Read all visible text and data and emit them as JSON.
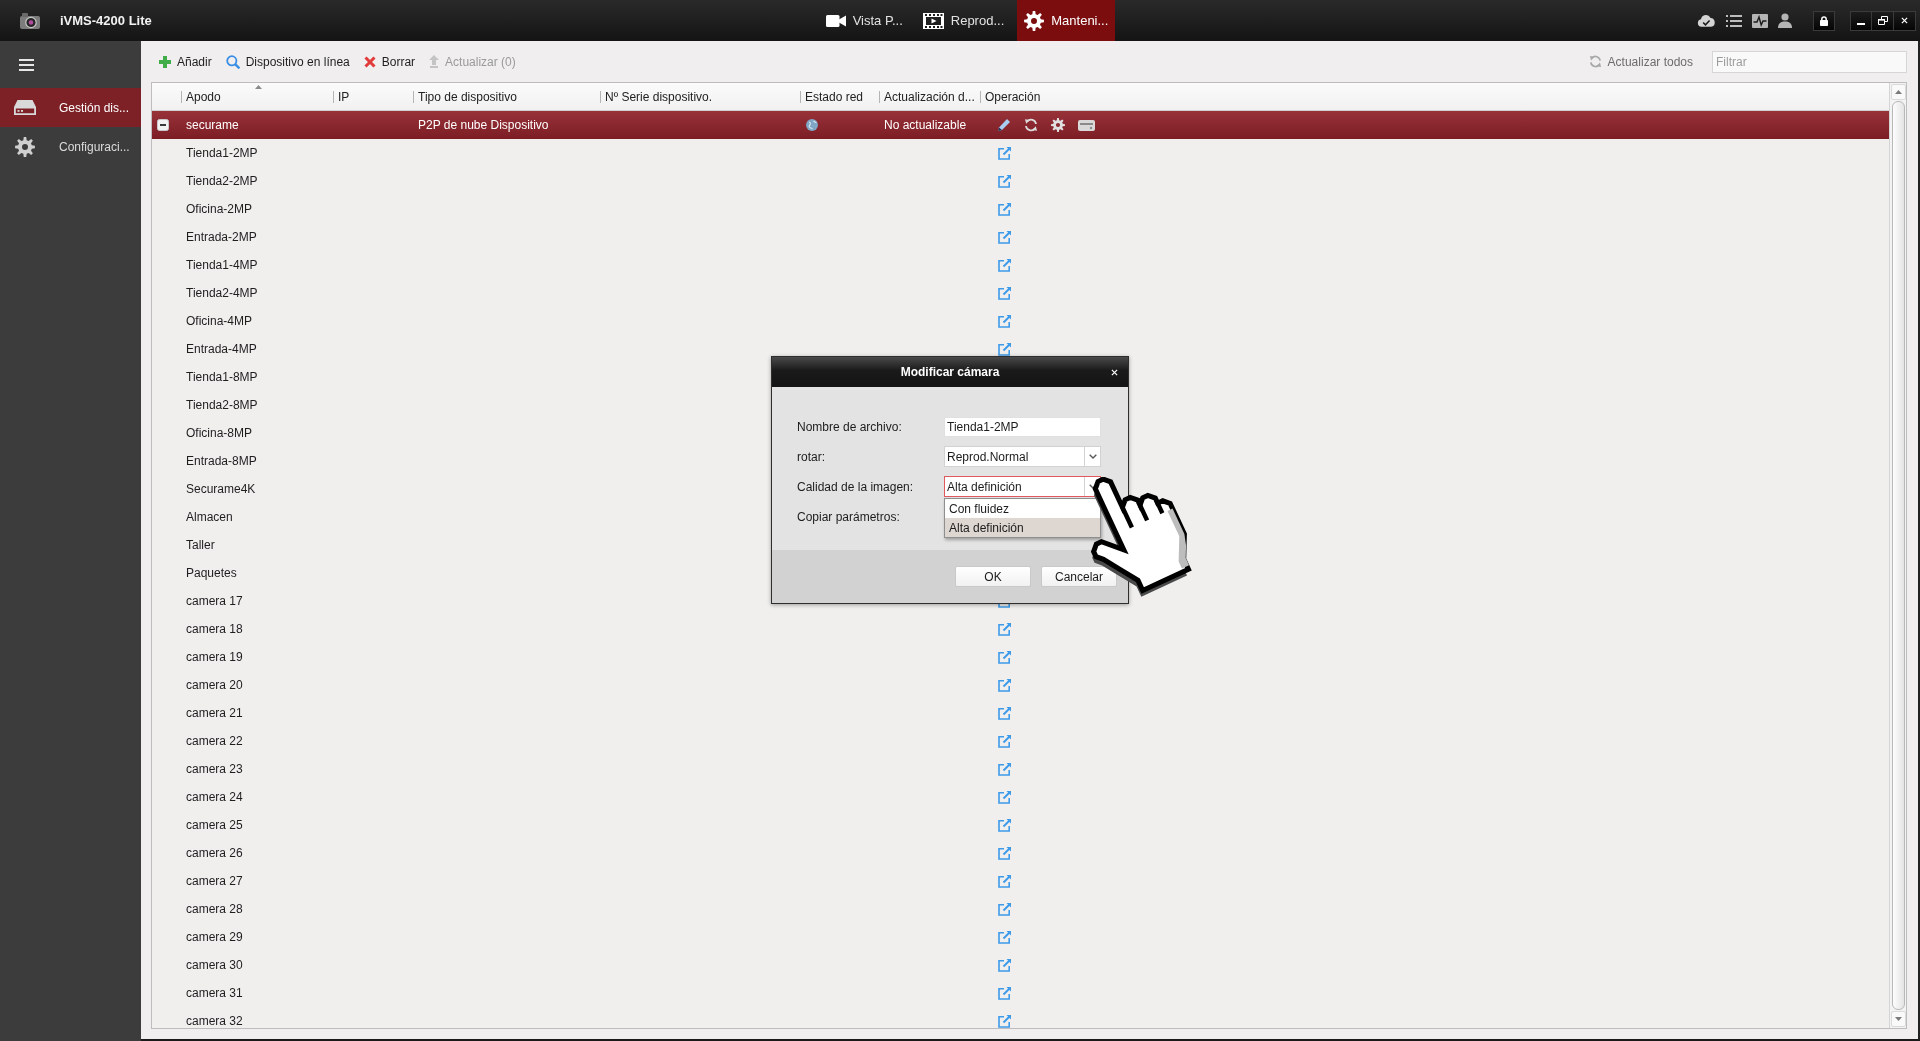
{
  "window": {
    "title": "iVMS-4200 Lite"
  },
  "main_tabs": [
    {
      "label": "Vista P...",
      "selected": false
    },
    {
      "label": "Reprod...",
      "selected": false
    },
    {
      "label": "Manteni...",
      "selected": true
    }
  ],
  "sidebar": {
    "items": [
      {
        "label": "Gestión dis...",
        "selected": true
      },
      {
        "label": "Configuraci...",
        "selected": false
      }
    ]
  },
  "toolbar": {
    "actions": [
      {
        "label": "Añadir",
        "disabled": false
      },
      {
        "label": "Dispositivo en línea",
        "disabled": false
      },
      {
        "label": "Borrar",
        "disabled": false
      },
      {
        "label": "Actualizar (0)",
        "disabled": true
      }
    ],
    "refresh_all": "Actualizar todos",
    "filter": {
      "placeholder": "Filtrar"
    }
  },
  "table": {
    "columns": [
      {
        "label": "Apodo",
        "sorted": true
      },
      {
        "label": "IP",
        "sorted": false
      },
      {
        "label": "Tipo de dispositivo",
        "sorted": false
      },
      {
        "label": "Nº Serie dispositivo.",
        "sorted": false
      },
      {
        "label": "Estado red",
        "sorted": false
      },
      {
        "label": "Actualización d...",
        "sorted": false
      },
      {
        "label": "Operación",
        "sorted": false
      }
    ],
    "rows": [
      {
        "name": "securame",
        "device_type": "P2P de nube Dispositivo",
        "update_status": "No actualizable",
        "expanded": true,
        "selected": true,
        "children": [
          {
            "name": "Tienda1-2MP",
            "selected": false
          },
          {
            "name": "Tienda2-2MP",
            "selected": false
          },
          {
            "name": "Oficina-2MP",
            "selected": false
          },
          {
            "name": "Entrada-2MP",
            "selected": false
          },
          {
            "name": "Tienda1-4MP",
            "selected": false
          },
          {
            "name": "Tienda2-4MP",
            "selected": false
          },
          {
            "name": "Oficina-4MP",
            "selected": false
          },
          {
            "name": "Entrada-4MP",
            "selected": false
          },
          {
            "name": "Tienda1-8MP",
            "selected": false
          },
          {
            "name": "Tienda2-8MP",
            "selected": false
          },
          {
            "name": "Oficina-8MP",
            "selected": false
          },
          {
            "name": "Entrada-8MP",
            "selected": false
          },
          {
            "name": "Securame4K",
            "selected": false
          },
          {
            "name": "Almacen",
            "selected": false
          },
          {
            "name": "Taller",
            "selected": false
          },
          {
            "name": "Paquetes",
            "selected": false
          },
          {
            "name": "camera 17",
            "selected": false
          },
          {
            "name": "camera 18",
            "selected": false
          },
          {
            "name": "camera 19",
            "selected": false
          },
          {
            "name": "camera 20",
            "selected": false
          },
          {
            "name": "camera 21",
            "selected": false
          },
          {
            "name": "camera 22",
            "selected": false
          },
          {
            "name": "camera 23",
            "selected": false
          },
          {
            "name": "camera 24",
            "selected": false
          },
          {
            "name": "camera 25",
            "selected": false
          },
          {
            "name": "camera 26",
            "selected": false
          },
          {
            "name": "camera 27",
            "selected": false
          },
          {
            "name": "camera 28",
            "selected": false
          },
          {
            "name": "camera 29",
            "selected": false
          },
          {
            "name": "camera 30",
            "selected": false
          },
          {
            "name": "camera 31",
            "selected": false
          },
          {
            "name": "camera 32",
            "selected": false
          }
        ]
      }
    ]
  },
  "dialog": {
    "title": "Modificar cámara",
    "fields": [
      {
        "kind": "text",
        "label": "Nombre de archivo:",
        "value": "Tienda1-2MP"
      },
      {
        "kind": "select",
        "label": "rotar:",
        "value": "Reprod.Normal",
        "focused": false
      },
      {
        "kind": "select",
        "label": "Calidad de la imagen:",
        "value": "Alta definición",
        "focused": true,
        "open": true,
        "options": [
          {
            "label": "Con fluidez",
            "selected": false
          },
          {
            "label": "Alta definición",
            "selected": true
          }
        ]
      },
      {
        "kind": "label",
        "label": "Copiar parámetros:"
      }
    ],
    "buttons": [
      "OK",
      "Cancelar"
    ]
  }
}
